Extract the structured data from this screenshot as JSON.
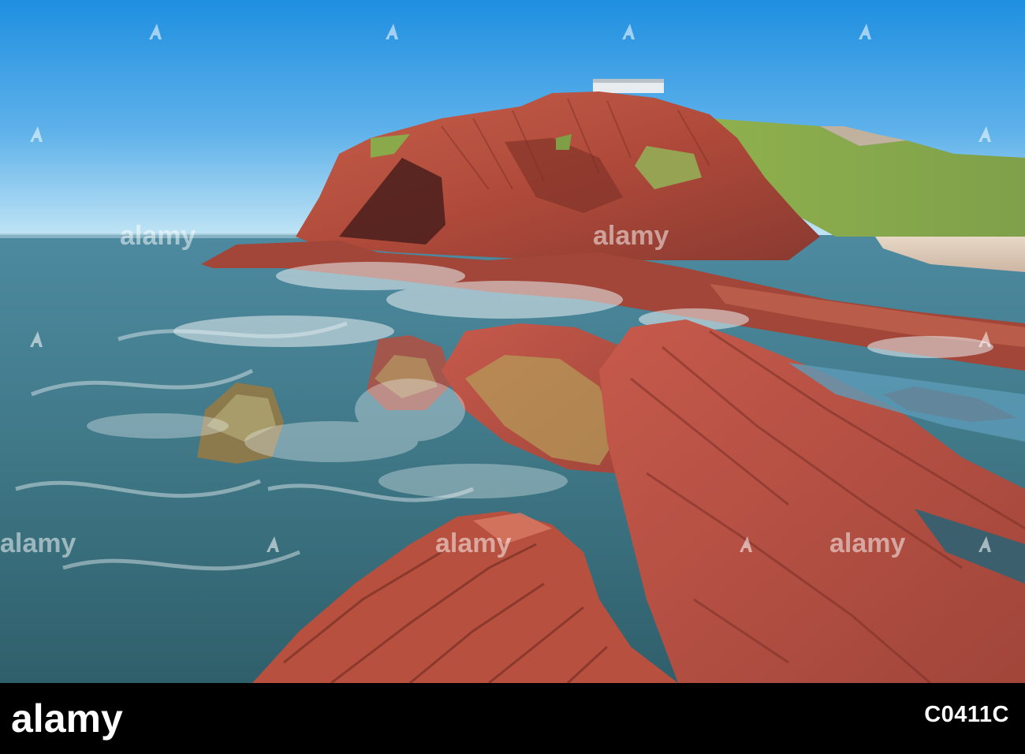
{
  "image": {
    "subject": "red rock sea cliff with waves",
    "watermark_text": "alamy",
    "watermark_icon": "alamy-a-icon"
  },
  "footer": {
    "logo_text": "alamy",
    "stock_id": "C0411C"
  },
  "colors": {
    "sky_top": "#1f8fe0",
    "sky_bottom": "#bde4f6",
    "sea": "#3f7d8b",
    "rock": "#b54a3d",
    "grass": "#88ab4e",
    "footer_bg": "#000000"
  }
}
